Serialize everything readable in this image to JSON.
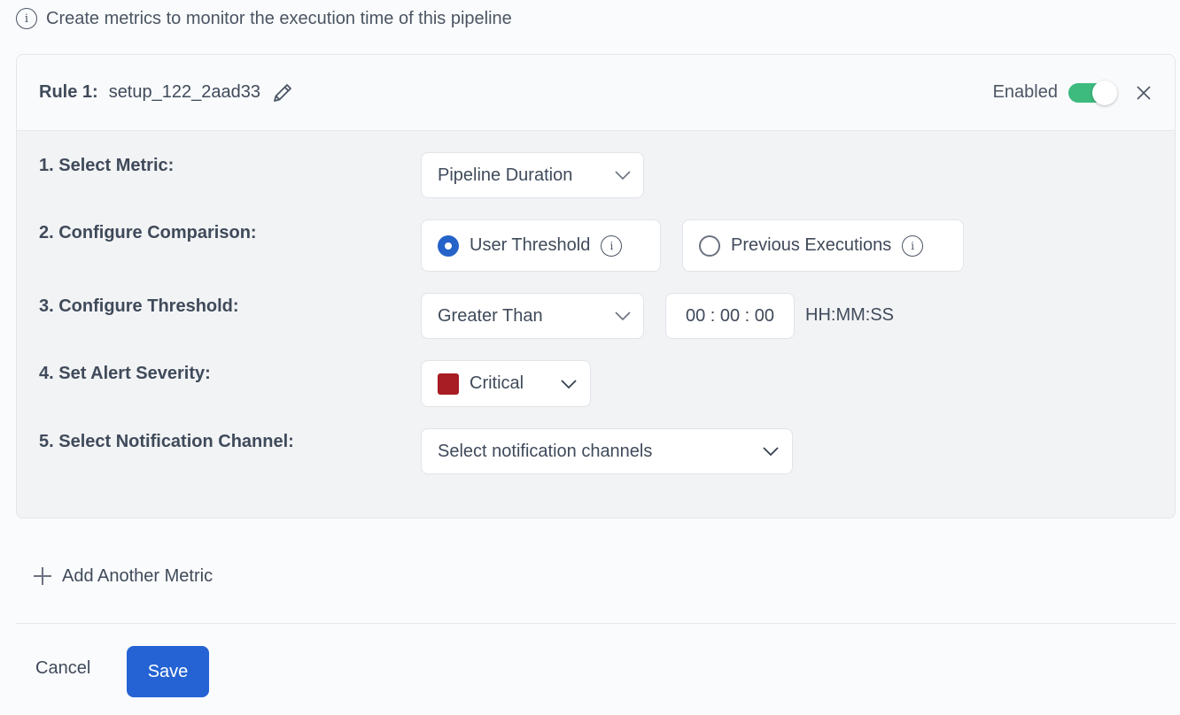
{
  "info": {
    "icon": "info-icon",
    "text": "Create metrics to monitor the execution time of this pipeline"
  },
  "rule": {
    "label": "Rule 1:",
    "name": "setup_122_2aad33",
    "edit_icon": "pencil-icon",
    "enabled_label": "Enabled",
    "enabled": true,
    "close_icon": "close-icon"
  },
  "steps": {
    "metric": {
      "label": "1. Select Metric:",
      "value": "Pipeline Duration"
    },
    "comparison": {
      "label": "2. Configure Comparison:",
      "options": [
        {
          "label": "User Threshold",
          "checked": true
        },
        {
          "label": "Previous Executions",
          "checked": false
        }
      ]
    },
    "threshold": {
      "label": "3. Configure Threshold:",
      "operator": "Greater Than",
      "time_value": "00 : 00 : 00",
      "time_format": "HH:MM:SS"
    },
    "severity": {
      "label": "4. Set Alert Severity:",
      "value": "Critical",
      "color": "#a81c23"
    },
    "notification": {
      "label": "5. Select Notification Channel:",
      "placeholder": "Select notification channels"
    }
  },
  "add_metric_label": "Add Another Metric",
  "footer": {
    "cancel_label": "Cancel",
    "save_label": "Save"
  },
  "colors": {
    "primary": "#2563d4",
    "toggle_on": "#3dba7e",
    "critical": "#a81c23"
  }
}
